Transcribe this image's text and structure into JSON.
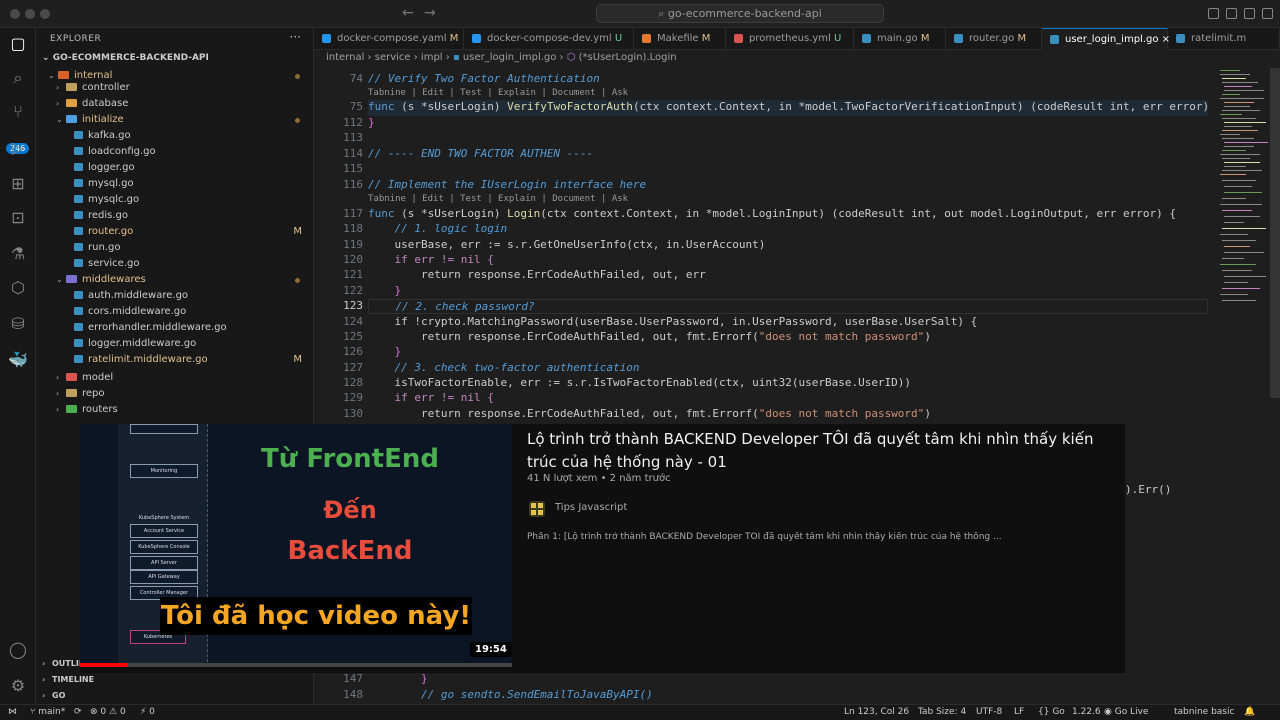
{
  "window": {
    "title": "go-ecommerce-backend-api"
  },
  "activity_bar": {
    "badge": "246",
    "icons": [
      "files-icon",
      "search-icon",
      "source-control-icon",
      "run-debug-icon",
      "extensions-icon",
      "remote-explorer-icon",
      "testing-icon",
      "containers-icon",
      "docker-icon",
      "account-icon",
      "manage-gear-icon"
    ]
  },
  "explorer": {
    "title": "EXPLORER",
    "more": "···",
    "project": "GO-ECOMMERCE-BACKEND-API",
    "items": [
      {
        "label": "internal",
        "mark": ""
      },
      {
        "label": "controller",
        "mark": ""
      },
      {
        "label": "database",
        "mark": ""
      },
      {
        "label": "initialize",
        "mark": ""
      },
      {
        "label": "kafka.go",
        "mark": ""
      },
      {
        "label": "loadconfig.go",
        "mark": ""
      },
      {
        "label": "logger.go",
        "mark": ""
      },
      {
        "label": "mysql.go",
        "mark": ""
      },
      {
        "label": "mysqlc.go",
        "mark": ""
      },
      {
        "label": "redis.go",
        "mark": ""
      },
      {
        "label": "router.go",
        "mark": "M"
      },
      {
        "label": "run.go",
        "mark": ""
      },
      {
        "label": "service.go",
        "mark": ""
      },
      {
        "label": "middlewares",
        "mark": ""
      },
      {
        "label": "auth.middleware.go",
        "mark": ""
      },
      {
        "label": "cors.middleware.go",
        "mark": ""
      },
      {
        "label": "errorhandler.middleware.go",
        "mark": ""
      },
      {
        "label": "logger.middleware.go",
        "mark": ""
      },
      {
        "label": "ratelimit.middleware.go",
        "mark": "M"
      },
      {
        "label": "model",
        "mark": ""
      },
      {
        "label": "repo",
        "mark": ""
      },
      {
        "label": "routers",
        "mark": ""
      }
    ],
    "footer": {
      "outline": "OUTLINE",
      "timeline": "TIMELINE",
      "go": "GO"
    }
  },
  "tabs": [
    {
      "label": "docker-compose.yaml",
      "mark": "M"
    },
    {
      "label": "docker-compose-dev.yml",
      "mark": "U"
    },
    {
      "label": "Makefile",
      "mark": "M"
    },
    {
      "label": "prometheus.yml",
      "mark": "U"
    },
    {
      "label": "main.go",
      "mark": "M"
    },
    {
      "label": "router.go",
      "mark": "M"
    },
    {
      "label": "user_login_impl.go",
      "mark": "×"
    },
    {
      "label": "ratelimit.m",
      "mark": ""
    }
  ],
  "breadcrumb": {
    "p1": "internal",
    "p2": "service",
    "p3": "impl",
    "p4": "user_login_impl.go",
    "p5": "(*sUserLogin).Login"
  },
  "editor": {
    "lens": "Tabnine | Edit | Test | Explain | Document | Ask",
    "line_numbers": [
      "74",
      "75",
      "112",
      "113",
      "114",
      "115",
      "116",
      "117",
      "118",
      "119",
      "120",
      "121",
      "122",
      "123",
      "124",
      "125",
      "126",
      "127",
      "128",
      "129",
      "130"
    ],
    "bottom_lines": [
      "147",
      "148"
    ],
    "code": {
      "l74": "// Verify Two Factor Authentication",
      "l75a": "func",
      "l75b": " (s *sUserLogin) ",
      "l75c": "VerifyTwoFactorAuth",
      "l75d": "(ctx context.Context, in *model.TwoFactorVerificationInput) (codeResult int, err error) {",
      "l75e": "…",
      "l112": "}",
      "l114": "// ---- END TWO FACTOR AUTHEN ----",
      "l116": "// Implement the IUserLogin interface here",
      "l117a": "func",
      "l117b": " (s *sUserLogin) ",
      "l117c": "Login",
      "l117d": "(ctx context.Context, in *model.LoginInput) (codeResult int, out model.LoginOutput, err error) {",
      "l118": "    // 1. logic login",
      "l119": "    userBase, err := s.r.GetOneUserInfo(ctx, in.UserAccount)",
      "l120": "    if err != nil {",
      "l121": "        return response.ErrCodeAuthFailed, out, err",
      "l122": "    }",
      "l123": "    // 2. check password?",
      "l124": "    if !crypto.MatchingPassword(userBase.UserPassword, in.UserPassword, userBase.UserSalt) {",
      "l125a": "        return response.ErrCodeAuthFailed, out, fmt.Errorf(",
      "l125b": "\"does not match password\"",
      "l125c": ")",
      "l126": "    }",
      "l127": "    // 3. check two-factor authentication",
      "l128": "    isTwoFactorEnable, err := s.r.IsTwoFactorEnabled(ctx, uint32(userBase.UserID))",
      "l129": "    if err != nil {",
      "l130a": "        return response.ErrCodeAuthFailed, out, fmt.Errorf(",
      "l130b": "\"does not match password\"",
      "l130c": ")",
      "hidden_tail": ").Err()",
      "l147": "        }",
      "l148": "        // go sendto.SendEmailToJavaByAPI()"
    }
  },
  "status": {
    "branch": "main*",
    "sync": "⟳",
    "errors": "⊗ 0",
    "warnings": "⚠ 0",
    "ports": "⚡ 0",
    "position": "Ln 123, Col 26",
    "tabsize": "Tab Size: 4",
    "encoding": "UTF-8",
    "eol": "LF",
    "language": "Go",
    "goversion": "1.22.6",
    "golive": "Go Live",
    "tabnine": "tabnine basic"
  },
  "video": {
    "title": "Lộ trình trở thành BACKEND Developer TÔI đã quyết tâm khi nhìn thấy kiến trúc của hệ thống này - 01",
    "meta": "41 N lượt xem • 2 năm trước",
    "channel": "Tips Javascript",
    "description": "Phần 1: [Lộ trình trở thành BACKEND Developer TÔI đã quyết tâm khi nhìn thấy kiến trúc của hệ thống ...",
    "duration": "19:54",
    "progress": 0.11,
    "thumb": {
      "line1": "Từ FrontEnd",
      "line2": "Đến",
      "line3": "BackEnd",
      "banner": "Tôi đã học video này!",
      "boxes": [
        "Monitoring",
        "KubeSphere System",
        "Account Service",
        "KubeSphere Console",
        "API Server",
        "API Gateway",
        "Controller Manager",
        "Kubernetes"
      ]
    }
  },
  "colors": {
    "accent": "#0078d4",
    "red_title": "#e74c3c",
    "green_title": "#4caf50",
    "banner": "#f5a623"
  }
}
